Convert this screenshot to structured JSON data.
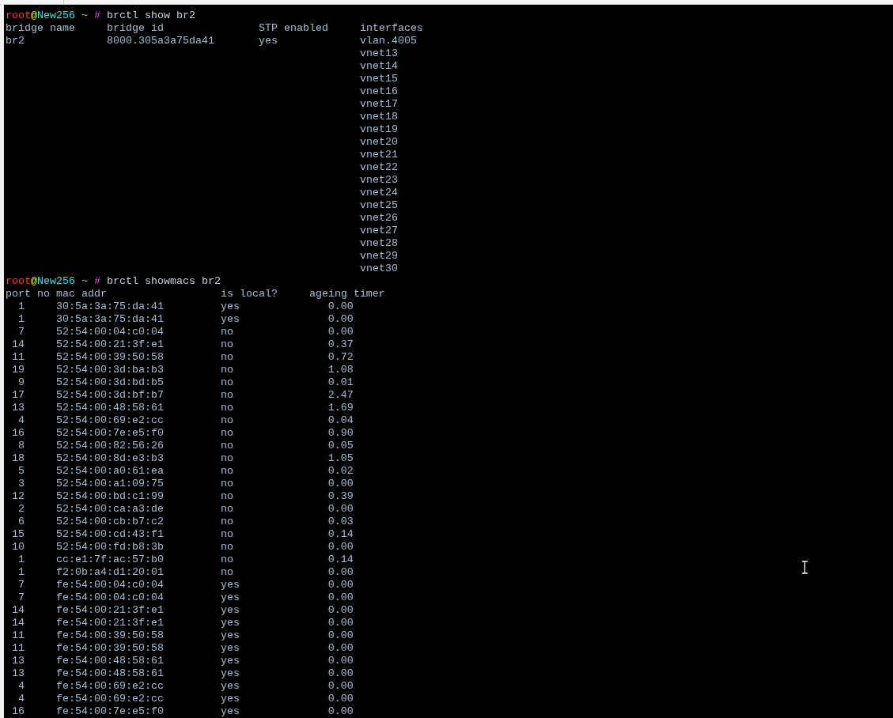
{
  "terminal": {
    "sessions": [
      {
        "prompt": {
          "user": "root",
          "at": "@",
          "host": "New256",
          "path": "~",
          "symbol": "#"
        },
        "command": "brctl show br2",
        "kind": "bridges",
        "columns": [
          "bridge name",
          "bridge id",
          "STP enabled",
          "interfaces"
        ],
        "rows": [
          {
            "bridge_name": "br2",
            "bridge_id": "8000.305a3a75da41",
            "stp_enabled": "yes",
            "interfaces": [
              "vlan.4005",
              "vnet13",
              "vnet14",
              "vnet15",
              "vnet16",
              "vnet17",
              "vnet18",
              "vnet19",
              "vnet20",
              "vnet21",
              "vnet22",
              "vnet23",
              "vnet24",
              "vnet25",
              "vnet26",
              "vnet27",
              "vnet28",
              "vnet29",
              "vnet30"
            ]
          }
        ]
      },
      {
        "prompt": {
          "user": "root",
          "at": "@",
          "host": "New256",
          "path": "~",
          "symbol": "#"
        },
        "command": "brctl showmacs br2",
        "kind": "macs",
        "columns": [
          "port no",
          "mac addr",
          "is local?",
          "ageing timer"
        ],
        "rows": [
          {
            "port": "1",
            "mac": "30:5a:3a:75:da:41",
            "local": "yes",
            "timer": "0.00"
          },
          {
            "port": "1",
            "mac": "30:5a:3a:75:da:41",
            "local": "yes",
            "timer": "0.00"
          },
          {
            "port": "7",
            "mac": "52:54:00:04:c0:04",
            "local": "no",
            "timer": "0.00"
          },
          {
            "port": "14",
            "mac": "52:54:00:21:3f:e1",
            "local": "no",
            "timer": "0.37"
          },
          {
            "port": "11",
            "mac": "52:54:00:39:50:58",
            "local": "no",
            "timer": "0.72"
          },
          {
            "port": "19",
            "mac": "52:54:00:3d:ba:b3",
            "local": "no",
            "timer": "1.08"
          },
          {
            "port": "9",
            "mac": "52:54:00:3d:bd:b5",
            "local": "no",
            "timer": "0.01"
          },
          {
            "port": "17",
            "mac": "52:54:00:3d:bf:b7",
            "local": "no",
            "timer": "2.47"
          },
          {
            "port": "13",
            "mac": "52:54:00:48:58:61",
            "local": "no",
            "timer": "1.69"
          },
          {
            "port": "4",
            "mac": "52:54:00:69:e2:cc",
            "local": "no",
            "timer": "0.04"
          },
          {
            "port": "16",
            "mac": "52:54:00:7e:e5:f0",
            "local": "no",
            "timer": "0.90"
          },
          {
            "port": "8",
            "mac": "52:54:00:82:56:26",
            "local": "no",
            "timer": "0.05"
          },
          {
            "port": "18",
            "mac": "52:54:00:8d:e3:b3",
            "local": "no",
            "timer": "1.05"
          },
          {
            "port": "5",
            "mac": "52:54:00:a0:61:ea",
            "local": "no",
            "timer": "0.02"
          },
          {
            "port": "3",
            "mac": "52:54:00:a1:09:75",
            "local": "no",
            "timer": "0.00"
          },
          {
            "port": "12",
            "mac": "52:54:00:bd:c1:99",
            "local": "no",
            "timer": "0.39"
          },
          {
            "port": "2",
            "mac": "52:54:00:ca:a3:de",
            "local": "no",
            "timer": "0.00"
          },
          {
            "port": "6",
            "mac": "52:54:00:cb:b7:c2",
            "local": "no",
            "timer": "0.03"
          },
          {
            "port": "15",
            "mac": "52:54:00:cd:43:f1",
            "local": "no",
            "timer": "0.14"
          },
          {
            "port": "10",
            "mac": "52:54:00:fd:b8:3b",
            "local": "no",
            "timer": "0.00"
          },
          {
            "port": "1",
            "mac": "cc:e1:7f:ac:57:b0",
            "local": "no",
            "timer": "0.14"
          },
          {
            "port": "1",
            "mac": "f2:0b:a4:d1:20:01",
            "local": "no",
            "timer": "0.00"
          },
          {
            "port": "7",
            "mac": "fe:54:00:04:c0:04",
            "local": "yes",
            "timer": "0.00"
          },
          {
            "port": "7",
            "mac": "fe:54:00:04:c0:04",
            "local": "yes",
            "timer": "0.00"
          },
          {
            "port": "14",
            "mac": "fe:54:00:21:3f:e1",
            "local": "yes",
            "timer": "0.00"
          },
          {
            "port": "14",
            "mac": "fe:54:00:21:3f:e1",
            "local": "yes",
            "timer": "0.00"
          },
          {
            "port": "11",
            "mac": "fe:54:00:39:50:58",
            "local": "yes",
            "timer": "0.00"
          },
          {
            "port": "11",
            "mac": "fe:54:00:39:50:58",
            "local": "yes",
            "timer": "0.00"
          },
          {
            "port": "13",
            "mac": "fe:54:00:48:58:61",
            "local": "yes",
            "timer": "0.00"
          },
          {
            "port": "13",
            "mac": "fe:54:00:48:58:61",
            "local": "yes",
            "timer": "0.00"
          },
          {
            "port": "4",
            "mac": "fe:54:00:69:e2:cc",
            "local": "yes",
            "timer": "0.00"
          },
          {
            "port": "4",
            "mac": "fe:54:00:69:e2:cc",
            "local": "yes",
            "timer": "0.00"
          },
          {
            "port": "16",
            "mac": "fe:54:00:7e:e5:f0",
            "local": "yes",
            "timer": "0.00"
          }
        ]
      }
    ]
  }
}
